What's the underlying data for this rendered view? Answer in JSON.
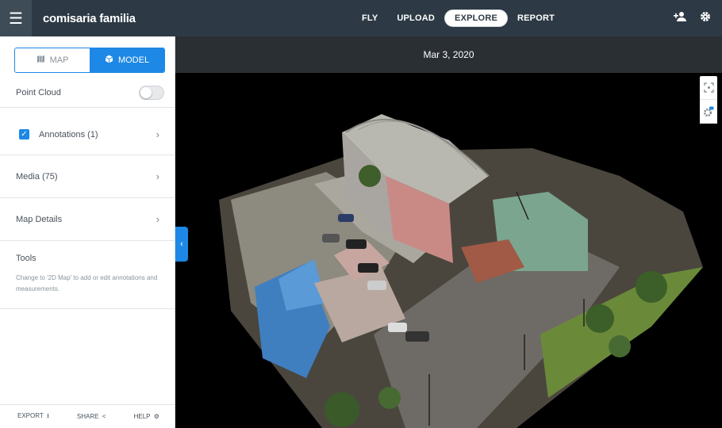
{
  "topbar": {
    "title": "comisaria familia",
    "nav": [
      {
        "label": "FLY"
      },
      {
        "label": "UPLOAD"
      },
      {
        "label": "EXPLORE"
      },
      {
        "label": "REPORT"
      }
    ],
    "active_nav": "EXPLORE"
  },
  "sidebar": {
    "view_toggle": {
      "map_label": "MAP",
      "model_label": "MODEL",
      "selected": "MODEL"
    },
    "point_cloud": {
      "label": "Point Cloud",
      "enabled": false
    },
    "annotations": {
      "label": "Annotations (1)",
      "checked": true
    },
    "media": {
      "label": "Media (75)"
    },
    "map_details": {
      "label": "Map Details"
    },
    "tools": {
      "title": "Tools",
      "description": "Change to '2D Map' to add or edit annotations and measurements."
    },
    "footer": {
      "export_label": "EXPORT",
      "share_label": "SHARE",
      "help_label": "HELP"
    }
  },
  "viewer": {
    "date": "Mar 3, 2020"
  },
  "icons": {
    "menu": "hamburger-icon",
    "add_user": "add-user-icon",
    "settings": "gear-icon",
    "map": "map-icon",
    "model": "cube-icon",
    "focus": "focus-icon",
    "model_settings": "model-settings-icon"
  },
  "colors": {
    "topbar": "#2d3a45",
    "accent": "#1d88e5",
    "viewer_bg": "#000000"
  }
}
